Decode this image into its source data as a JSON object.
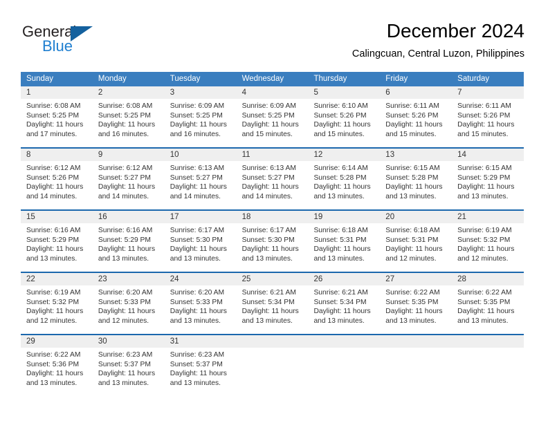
{
  "logo": {
    "primary_text": "General",
    "secondary_text": "Blue",
    "triangle_color": "#14619e",
    "secondary_color": "#1f7fd0"
  },
  "header": {
    "title": "December 2024",
    "subtitle": "Calingcuan, Central Luzon, Philippines"
  },
  "theme": {
    "header_bar_color": "#3a7ebf",
    "row_divider_color": "#1b68ad",
    "day_number_bg": "#efefef",
    "text_color": "#333333"
  },
  "calendar": {
    "weekdays": [
      "Sunday",
      "Monday",
      "Tuesday",
      "Wednesday",
      "Thursday",
      "Friday",
      "Saturday"
    ],
    "weeks": [
      [
        {
          "day": "1",
          "sunrise": "Sunrise: 6:08 AM",
          "sunset": "Sunset: 5:25 PM",
          "daylight_1": "Daylight: 11 hours",
          "daylight_2": "and 17 minutes."
        },
        {
          "day": "2",
          "sunrise": "Sunrise: 6:08 AM",
          "sunset": "Sunset: 5:25 PM",
          "daylight_1": "Daylight: 11 hours",
          "daylight_2": "and 16 minutes."
        },
        {
          "day": "3",
          "sunrise": "Sunrise: 6:09 AM",
          "sunset": "Sunset: 5:25 PM",
          "daylight_1": "Daylight: 11 hours",
          "daylight_2": "and 16 minutes."
        },
        {
          "day": "4",
          "sunrise": "Sunrise: 6:09 AM",
          "sunset": "Sunset: 5:25 PM",
          "daylight_1": "Daylight: 11 hours",
          "daylight_2": "and 15 minutes."
        },
        {
          "day": "5",
          "sunrise": "Sunrise: 6:10 AM",
          "sunset": "Sunset: 5:26 PM",
          "daylight_1": "Daylight: 11 hours",
          "daylight_2": "and 15 minutes."
        },
        {
          "day": "6",
          "sunrise": "Sunrise: 6:11 AM",
          "sunset": "Sunset: 5:26 PM",
          "daylight_1": "Daylight: 11 hours",
          "daylight_2": "and 15 minutes."
        },
        {
          "day": "7",
          "sunrise": "Sunrise: 6:11 AM",
          "sunset": "Sunset: 5:26 PM",
          "daylight_1": "Daylight: 11 hours",
          "daylight_2": "and 15 minutes."
        }
      ],
      [
        {
          "day": "8",
          "sunrise": "Sunrise: 6:12 AM",
          "sunset": "Sunset: 5:26 PM",
          "daylight_1": "Daylight: 11 hours",
          "daylight_2": "and 14 minutes."
        },
        {
          "day": "9",
          "sunrise": "Sunrise: 6:12 AM",
          "sunset": "Sunset: 5:27 PM",
          "daylight_1": "Daylight: 11 hours",
          "daylight_2": "and 14 minutes."
        },
        {
          "day": "10",
          "sunrise": "Sunrise: 6:13 AM",
          "sunset": "Sunset: 5:27 PM",
          "daylight_1": "Daylight: 11 hours",
          "daylight_2": "and 14 minutes."
        },
        {
          "day": "11",
          "sunrise": "Sunrise: 6:13 AM",
          "sunset": "Sunset: 5:27 PM",
          "daylight_1": "Daylight: 11 hours",
          "daylight_2": "and 14 minutes."
        },
        {
          "day": "12",
          "sunrise": "Sunrise: 6:14 AM",
          "sunset": "Sunset: 5:28 PM",
          "daylight_1": "Daylight: 11 hours",
          "daylight_2": "and 13 minutes."
        },
        {
          "day": "13",
          "sunrise": "Sunrise: 6:15 AM",
          "sunset": "Sunset: 5:28 PM",
          "daylight_1": "Daylight: 11 hours",
          "daylight_2": "and 13 minutes."
        },
        {
          "day": "14",
          "sunrise": "Sunrise: 6:15 AM",
          "sunset": "Sunset: 5:29 PM",
          "daylight_1": "Daylight: 11 hours",
          "daylight_2": "and 13 minutes."
        }
      ],
      [
        {
          "day": "15",
          "sunrise": "Sunrise: 6:16 AM",
          "sunset": "Sunset: 5:29 PM",
          "daylight_1": "Daylight: 11 hours",
          "daylight_2": "and 13 minutes."
        },
        {
          "day": "16",
          "sunrise": "Sunrise: 6:16 AM",
          "sunset": "Sunset: 5:29 PM",
          "daylight_1": "Daylight: 11 hours",
          "daylight_2": "and 13 minutes."
        },
        {
          "day": "17",
          "sunrise": "Sunrise: 6:17 AM",
          "sunset": "Sunset: 5:30 PM",
          "daylight_1": "Daylight: 11 hours",
          "daylight_2": "and 13 minutes."
        },
        {
          "day": "18",
          "sunrise": "Sunrise: 6:17 AM",
          "sunset": "Sunset: 5:30 PM",
          "daylight_1": "Daylight: 11 hours",
          "daylight_2": "and 13 minutes."
        },
        {
          "day": "19",
          "sunrise": "Sunrise: 6:18 AM",
          "sunset": "Sunset: 5:31 PM",
          "daylight_1": "Daylight: 11 hours",
          "daylight_2": "and 13 minutes."
        },
        {
          "day": "20",
          "sunrise": "Sunrise: 6:18 AM",
          "sunset": "Sunset: 5:31 PM",
          "daylight_1": "Daylight: 11 hours",
          "daylight_2": "and 12 minutes."
        },
        {
          "day": "21",
          "sunrise": "Sunrise: 6:19 AM",
          "sunset": "Sunset: 5:32 PM",
          "daylight_1": "Daylight: 11 hours",
          "daylight_2": "and 12 minutes."
        }
      ],
      [
        {
          "day": "22",
          "sunrise": "Sunrise: 6:19 AM",
          "sunset": "Sunset: 5:32 PM",
          "daylight_1": "Daylight: 11 hours",
          "daylight_2": "and 12 minutes."
        },
        {
          "day": "23",
          "sunrise": "Sunrise: 6:20 AM",
          "sunset": "Sunset: 5:33 PM",
          "daylight_1": "Daylight: 11 hours",
          "daylight_2": "and 12 minutes."
        },
        {
          "day": "24",
          "sunrise": "Sunrise: 6:20 AM",
          "sunset": "Sunset: 5:33 PM",
          "daylight_1": "Daylight: 11 hours",
          "daylight_2": "and 13 minutes."
        },
        {
          "day": "25",
          "sunrise": "Sunrise: 6:21 AM",
          "sunset": "Sunset: 5:34 PM",
          "daylight_1": "Daylight: 11 hours",
          "daylight_2": "and 13 minutes."
        },
        {
          "day": "26",
          "sunrise": "Sunrise: 6:21 AM",
          "sunset": "Sunset: 5:34 PM",
          "daylight_1": "Daylight: 11 hours",
          "daylight_2": "and 13 minutes."
        },
        {
          "day": "27",
          "sunrise": "Sunrise: 6:22 AM",
          "sunset": "Sunset: 5:35 PM",
          "daylight_1": "Daylight: 11 hours",
          "daylight_2": "and 13 minutes."
        },
        {
          "day": "28",
          "sunrise": "Sunrise: 6:22 AM",
          "sunset": "Sunset: 5:35 PM",
          "daylight_1": "Daylight: 11 hours",
          "daylight_2": "and 13 minutes."
        }
      ],
      [
        {
          "day": "29",
          "sunrise": "Sunrise: 6:22 AM",
          "sunset": "Sunset: 5:36 PM",
          "daylight_1": "Daylight: 11 hours",
          "daylight_2": "and 13 minutes."
        },
        {
          "day": "30",
          "sunrise": "Sunrise: 6:23 AM",
          "sunset": "Sunset: 5:37 PM",
          "daylight_1": "Daylight: 11 hours",
          "daylight_2": "and 13 minutes."
        },
        {
          "day": "31",
          "sunrise": "Sunrise: 6:23 AM",
          "sunset": "Sunset: 5:37 PM",
          "daylight_1": "Daylight: 11 hours",
          "daylight_2": "and 13 minutes."
        },
        {
          "day": "",
          "sunrise": "",
          "sunset": "",
          "daylight_1": "",
          "daylight_2": ""
        },
        {
          "day": "",
          "sunrise": "",
          "sunset": "",
          "daylight_1": "",
          "daylight_2": ""
        },
        {
          "day": "",
          "sunrise": "",
          "sunset": "",
          "daylight_1": "",
          "daylight_2": ""
        },
        {
          "day": "",
          "sunrise": "",
          "sunset": "",
          "daylight_1": "",
          "daylight_2": ""
        }
      ]
    ]
  }
}
